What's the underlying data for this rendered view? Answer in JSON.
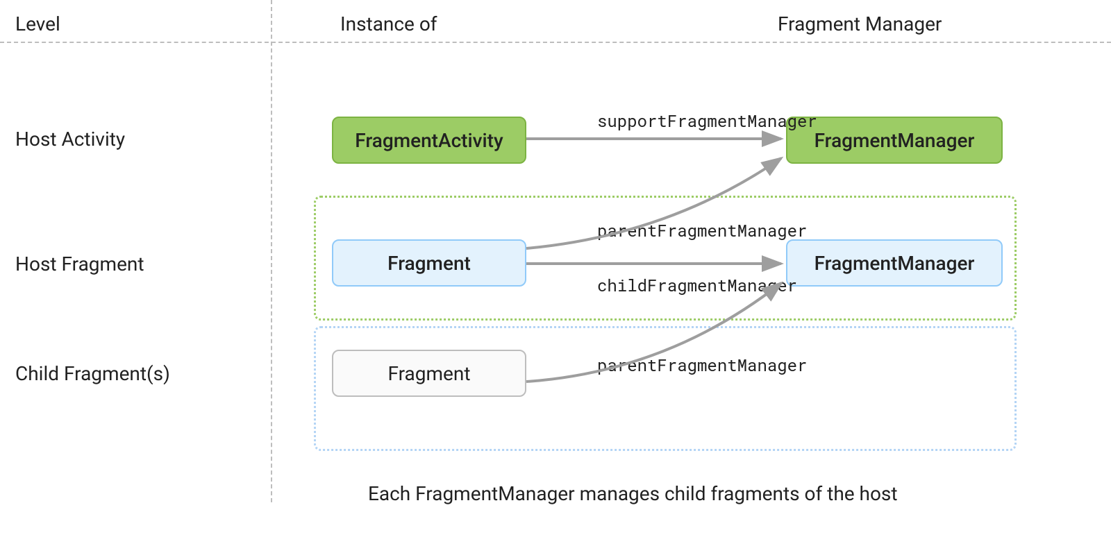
{
  "headers": {
    "level": "Level",
    "instance": "Instance of",
    "manager": "Fragment Manager"
  },
  "levels": {
    "host_activity": "Host Activity",
    "host_fragment": "Host Fragment",
    "child_fragments": "Child Fragment(s)"
  },
  "nodes": {
    "fragment_activity": "FragmentActivity",
    "fragment_manager_green": "FragmentManager",
    "fragment_blue": "Fragment",
    "fragment_manager_blue": "FragmentManager",
    "fragment_gray": "Fragment"
  },
  "edges": {
    "support_fm": "supportFragmentManager",
    "parent_fm": "parentFragmentManager",
    "child_fm": "childFragmentManager",
    "parent_fm2": "parentFragmentManager"
  },
  "footer": "Each FragmentManager manages child fragments of the host"
}
